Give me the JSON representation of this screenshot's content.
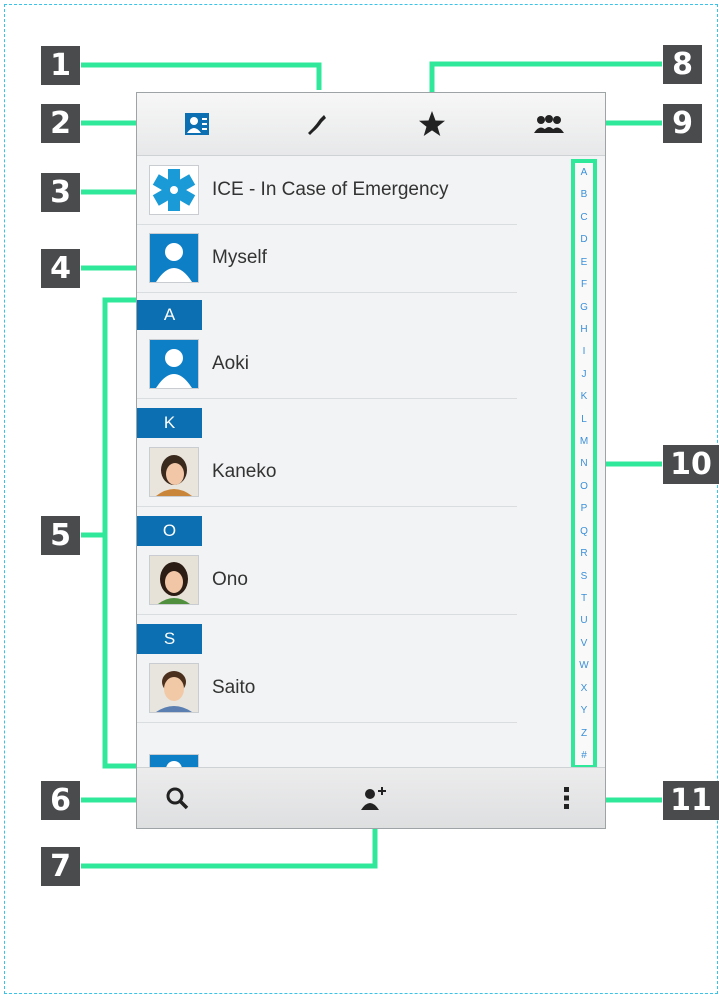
{
  "tabs": [
    {
      "label": "",
      "icon": "contacts-icon"
    },
    {
      "label": "",
      "icon": "phone-icon"
    },
    {
      "label": "",
      "icon": "star-icon"
    },
    {
      "label": "",
      "icon": "groups-icon"
    }
  ],
  "contacts": {
    "ice": "ICE - In Case of Emergency",
    "myself": "Myself",
    "sections": [
      "A",
      "K",
      "O",
      "S"
    ],
    "names": [
      "Aoki",
      "Kaneko",
      "Ono",
      "Saito"
    ]
  },
  "index_letters": [
    "A",
    "B",
    "C",
    "D",
    "E",
    "F",
    "G",
    "H",
    "I",
    "J",
    "K",
    "L",
    "M",
    "N",
    "O",
    "P",
    "Q",
    "R",
    "S",
    "T",
    "U",
    "V",
    "W",
    "X",
    "Y",
    "Z",
    "#"
  ],
  "bottom_bar": {
    "search_icon": "search-icon",
    "add_icon": "add-contact-icon",
    "menu_icon": "more-vertical-icon"
  },
  "callouts": [
    "1",
    "2",
    "3",
    "4",
    "5",
    "6",
    "7",
    "8",
    "9",
    "10",
    "11"
  ],
  "colors": {
    "accent": "#0b6fb1",
    "leader": "#2fe89a",
    "badge": "#4a4b4d",
    "index_text": "#3a8fd8",
    "frame": "#38c4e8"
  }
}
